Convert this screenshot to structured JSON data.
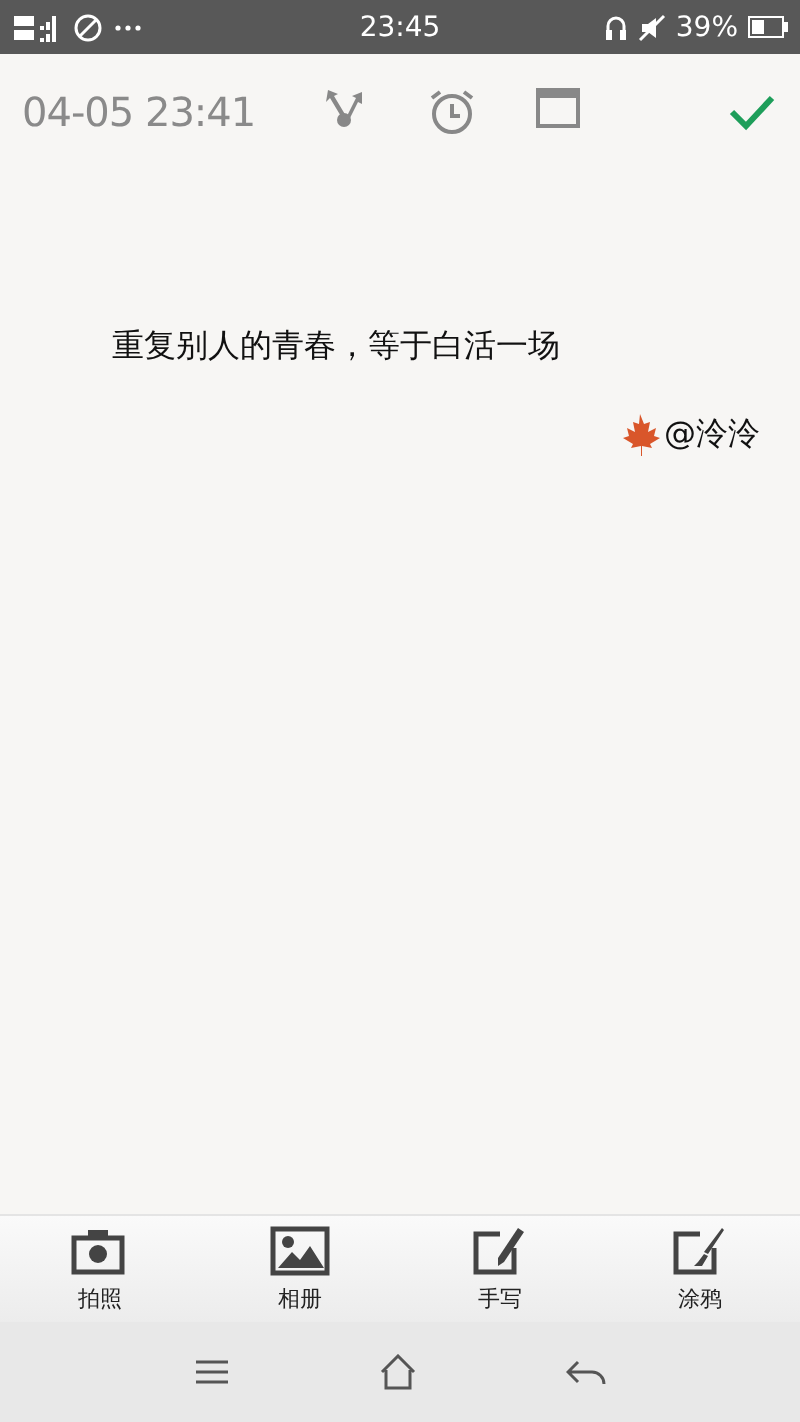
{
  "status_bar": {
    "time": "23:45",
    "battery": "39%"
  },
  "toolbar": {
    "timestamp": "04-05 23:41"
  },
  "note": {
    "text": "重复别人的青春，等于白活一场",
    "signature": "@泠泠"
  },
  "tools": [
    {
      "kind": "camera",
      "label": "拍照"
    },
    {
      "kind": "gallery",
      "label": "相册"
    },
    {
      "kind": "handwrite",
      "label": "手写"
    },
    {
      "kind": "doodle",
      "label": "涂鸦"
    }
  ]
}
